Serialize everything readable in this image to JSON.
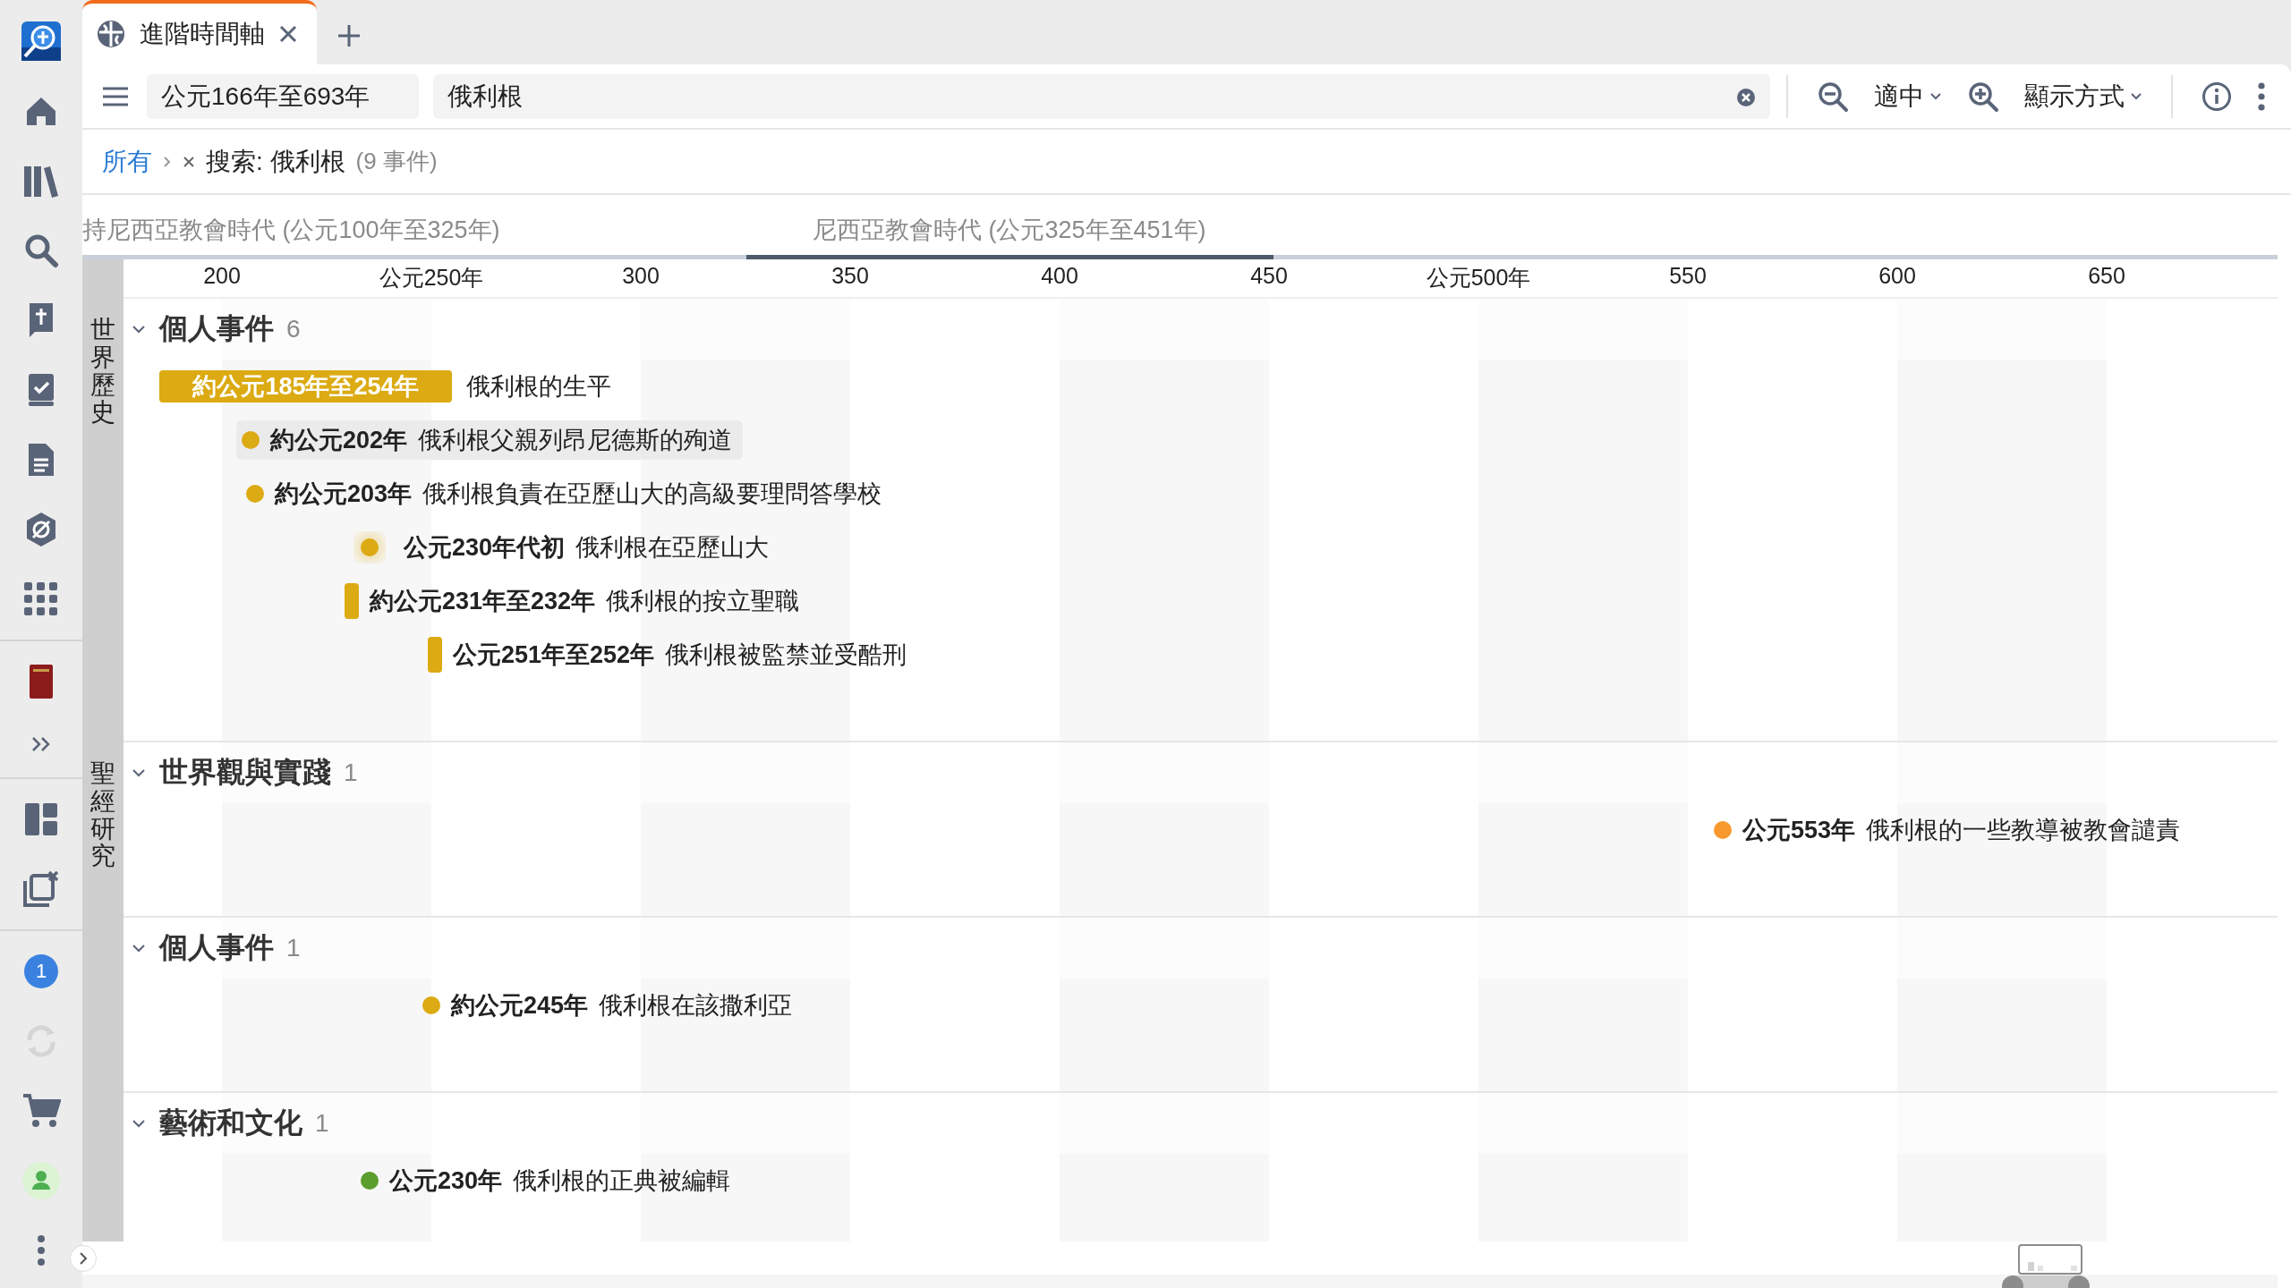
{
  "tabs": [
    {
      "title": "進階時間軸",
      "selected": true
    }
  ],
  "rail": {
    "badge": "1"
  },
  "toolbar": {
    "date_range": "公元166年至693年",
    "search": {
      "value": "俄利根"
    },
    "zoom": "適中",
    "display": "顯示方式"
  },
  "breadcrumb": {
    "root": "所有",
    "filter": "搜索: 俄利根",
    "count": "(9 事件)"
  },
  "eras": [
    {
      "label": "持尼西亞教會時代 (公元100年至325年)",
      "selected": false
    },
    {
      "label": "尼西亞教會時代 (公元325年至451年)",
      "selected": true
    }
  ],
  "axis": {
    "ticks": [
      "200",
      "公元250年",
      "300",
      "350",
      "400",
      "450",
      "公元500年",
      "550",
      "600",
      "650"
    ]
  },
  "sections": [
    {
      "label": "世界歷史",
      "groups": [
        {
          "title": "個人事件",
          "count": "6",
          "expanded": true,
          "events": [
            {
              "kind": "span",
              "date": "約公元185年至254年",
              "title": "俄利根的生平",
              "color": "#dcaa12",
              "selected": false
            },
            {
              "kind": "point",
              "date": "約公元202年",
              "title": "俄利根父親列昂尼德斯的殉道",
              "color": "#dcaa12",
              "selected": true
            },
            {
              "kind": "point",
              "date": "約公元203年",
              "title": "俄利根負責在亞歷山大的高級要理問答學校",
              "color": "#dcaa12",
              "selected": false
            },
            {
              "kind": "decade",
              "date": "公元230年代初",
              "title": "俄利根在亞歷山大",
              "color": "#dcaa12",
              "selected": false
            },
            {
              "kind": "range",
              "date": "約公元231年至232年",
              "title": "俄利根的按立聖職",
              "color": "#dcaa12",
              "selected": false
            },
            {
              "kind": "range",
              "date": "公元251年至252年",
              "title": "俄利根被監禁並受酷刑",
              "color": "#dcaa12",
              "selected": false
            }
          ]
        }
      ]
    },
    {
      "label": "聖經研究",
      "groups": [
        {
          "title": "世界觀與實踐",
          "count": "1",
          "expanded": true,
          "events": [
            {
              "kind": "point",
              "date": "公元553年",
              "title": "俄利根的一些教導被教會譴責",
              "color": "#f7992f",
              "selected": false
            }
          ]
        },
        {
          "title": "個人事件",
          "count": "1",
          "expanded": true,
          "events": [
            {
              "kind": "point",
              "date": "約公元245年",
              "title": "俄利根在該撒利亞",
              "color": "#dcaa12",
              "selected": false
            }
          ]
        },
        {
          "title": "藝術和文化",
          "count": "1",
          "expanded": true,
          "events": [
            {
              "kind": "point",
              "date": "公元230年",
              "title": "俄利根的正典被編輯",
              "color": "#5a9e2e",
              "selected": false
            }
          ]
        }
      ]
    }
  ]
}
